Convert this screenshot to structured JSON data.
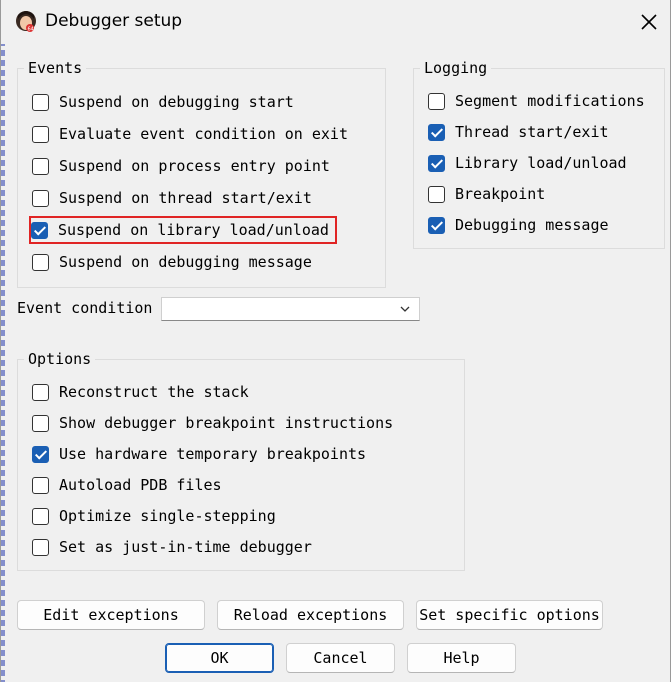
{
  "window": {
    "title": "Debugger setup"
  },
  "events": {
    "legend": "Events",
    "items": [
      {
        "label": "Suspend on debugging start",
        "checked": false
      },
      {
        "label": "Evaluate event condition on exit",
        "checked": false
      },
      {
        "label": "Suspend on process entry point",
        "checked": false
      },
      {
        "label": "Suspend on thread start/exit",
        "checked": false
      },
      {
        "label": "Suspend on library load/unload",
        "checked": true,
        "highlighted": true
      },
      {
        "label": "Suspend on debugging message",
        "checked": false
      }
    ]
  },
  "logging": {
    "legend": "Logging",
    "items": [
      {
        "label": "Segment modifications",
        "checked": false
      },
      {
        "label": "Thread start/exit",
        "checked": true
      },
      {
        "label": "Library load/unload",
        "checked": true
      },
      {
        "label": "Breakpoint",
        "checked": false
      },
      {
        "label": "Debugging message",
        "checked": true
      }
    ]
  },
  "event_condition": {
    "label": "Event condition",
    "value": ""
  },
  "options": {
    "legend": "Options",
    "items": [
      {
        "label": "Reconstruct the stack",
        "checked": false
      },
      {
        "label": "Show debugger breakpoint instructions",
        "checked": false
      },
      {
        "label": "Use hardware temporary breakpoints",
        "checked": true
      },
      {
        "label": "Autoload PDB files",
        "checked": false
      },
      {
        "label": "Optimize single-stepping",
        "checked": false
      },
      {
        "label": "Set as just-in-time debugger",
        "checked": false
      }
    ]
  },
  "buttons": {
    "edit_exceptions": "Edit exceptions",
    "reload_exceptions": "Reload exceptions",
    "set_specific_options": "Set specific options",
    "ok": "OK",
    "cancel": "Cancel",
    "help": "Help"
  },
  "colors": {
    "accent": "#1a5fb4",
    "highlight": "#e02424",
    "background": "#f0f0f0"
  }
}
